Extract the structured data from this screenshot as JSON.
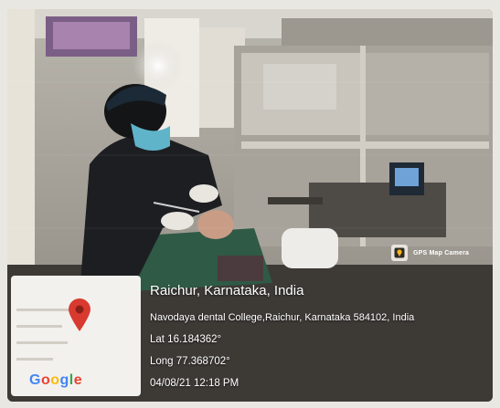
{
  "photo": {
    "description_icon": "dental-procedure-photo"
  },
  "badge": {
    "label": "GPS Map Camera",
    "icon": "gps-map-camera-icon"
  },
  "location": {
    "city": "Raichur, Karnataka, India",
    "address": "Navodaya dental College,Raichur, Karnataka 584102, India",
    "lat": "Lat 16.184362°",
    "long": "Long 77.368702°",
    "timestamp": "04/08/21 12:18 PM"
  },
  "map": {
    "logo": "Google",
    "pin_icon": "map-pin-icon",
    "pin_color": "#d93a2f"
  }
}
